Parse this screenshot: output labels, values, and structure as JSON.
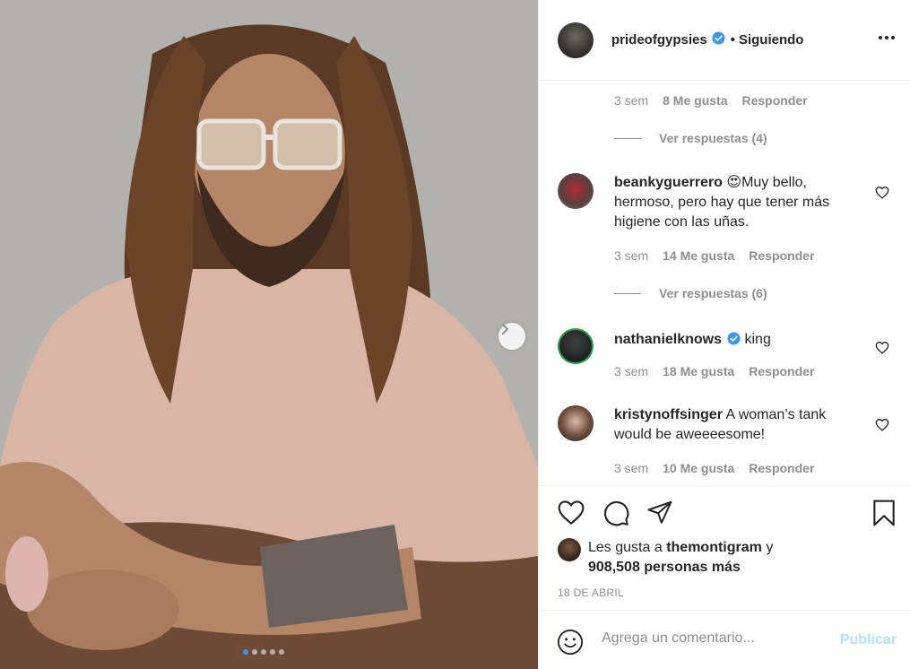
{
  "post": {
    "image_alt": "",
    "carousel": {
      "count": 5,
      "active_index": 0
    }
  },
  "header": {
    "username": "prideofgypsies",
    "separator": "•",
    "follow_status": "Siguiendo"
  },
  "comments": {
    "first_meta": {
      "time": "3 sem",
      "likes": "8 Me gusta",
      "reply": "Responder"
    },
    "first_replies": "Ver respuestas (4)",
    "items": [
      {
        "username": "beankyguerrero",
        "emoji": "😍",
        "text": "Muy bello, hermoso, pero hay que tener más higiene con las uñas.",
        "time": "3 sem",
        "likes": "14 Me gusta",
        "reply": "Responder",
        "replies": "Ver respuestas (6)"
      },
      {
        "username": "nathanielknows",
        "text": "king",
        "time": "3 sem",
        "likes": "18 Me gusta",
        "reply": "Responder"
      },
      {
        "username": "kristynoffsinger",
        "text": "A woman’s tank would be aweeeesome!",
        "time": "3 sem",
        "likes": "10 Me gusta",
        "reply": "Responder"
      }
    ]
  },
  "likes": {
    "prefix": "Les gusta a",
    "user": "themontigram",
    "connector": "y",
    "others": "908,508 personas más"
  },
  "date": "18 DE ABRIL",
  "add_comment": {
    "placeholder": "Agrega un comentario...",
    "publish": "Publicar"
  },
  "colors": {
    "accent": "#3897f0",
    "publish_disabled": "#b2dffc",
    "muted": "#8e8e8e",
    "text": "#262626"
  },
  "icons": [
    "verified-icon",
    "more-options-icon",
    "heart-icon",
    "comment-icon",
    "share-icon",
    "bookmark-icon",
    "emoji-icon",
    "next-arrow-icon"
  ]
}
